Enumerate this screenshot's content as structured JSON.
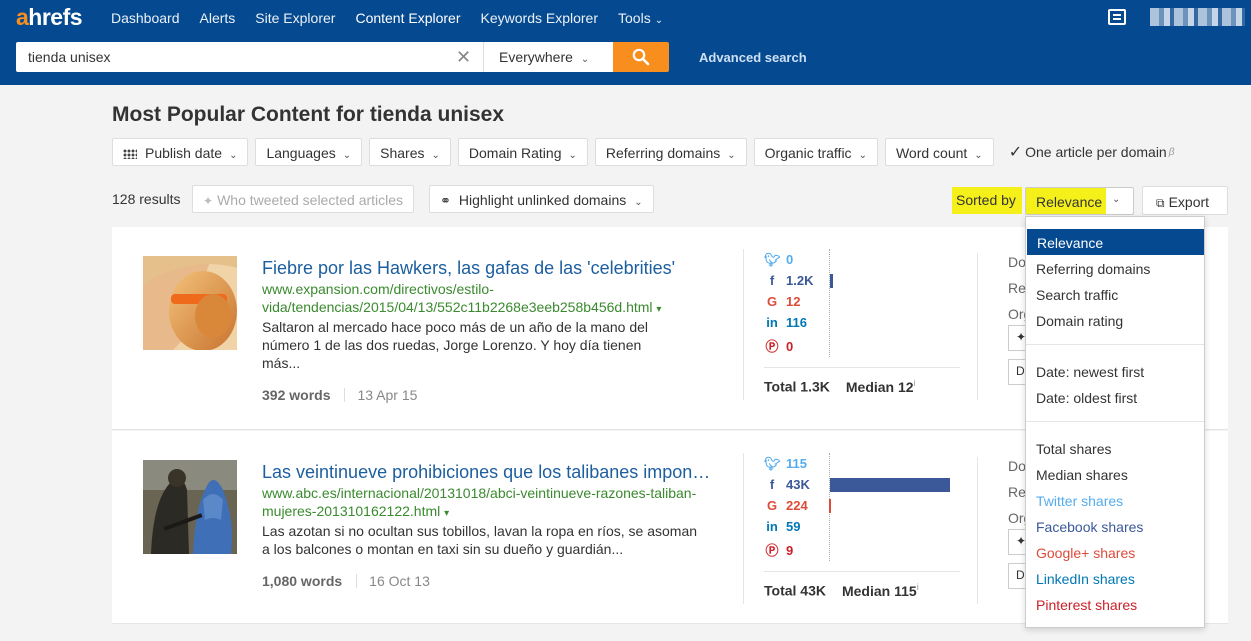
{
  "app": {
    "logo_a": "a",
    "logo_rest": "hrefs"
  },
  "nav": [
    {
      "label": "Dashboard"
    },
    {
      "label": "Alerts"
    },
    {
      "label": "Site Explorer"
    },
    {
      "label": "Content Explorer",
      "active": true
    },
    {
      "label": "Keywords Explorer"
    },
    {
      "label": "Tools",
      "has_dropdown": true
    }
  ],
  "search": {
    "query": "tienda unisex",
    "scope": "Everywhere",
    "advanced": "Advanced search"
  },
  "page_title": "Most Popular Content for tienda unisex",
  "filters": [
    "Publish date",
    "Languages",
    "Shares",
    "Domain Rating",
    "Referring domains",
    "Organic traffic",
    "Word count"
  ],
  "one_article": {
    "label": "One article per domain",
    "checked": true,
    "beta_mark": "β"
  },
  "toolbar": {
    "results": "128 results",
    "tweeted": "Who tweeted selected articles",
    "highlight": "Highlight unlinked domains",
    "sorted_by": "Sorted by",
    "sort_value": "Relevance",
    "export": "Export"
  },
  "results": [
    {
      "title": "Fiebre por las Hawkers, las gafas de las 'celebrities'",
      "url_line1": "www.expansion.com/directivos/estilo-",
      "url_line2": "vida/tendencias/2015/04/13/552c11b2268e3eeb258b456d.html",
      "desc_line1": "Saltaron al mercado hace poco más de un año de la mano del",
      "desc_line2": "número 1 de las dos ruedas, Jorge Lorenzo. Y hoy día tienen",
      "desc_line3": "más...",
      "words": "392 words",
      "date": "13 Apr 15",
      "shares": {
        "twitter": "0",
        "facebook": "1.2K",
        "google": "12",
        "linkedin": "116",
        "pinterest": "0",
        "facebook_bar_fraction": 0.028,
        "total": "Total 1.3K",
        "median": "Median 12"
      },
      "partial": [
        "Do",
        "Re",
        "Org"
      ]
    },
    {
      "title": "Las veintinueve prohibiciones que los talibanes impon…",
      "url_line1": "www.abc.es/internacional/20131018/abci-veintinueve-razones-taliban-",
      "url_line2": "mujeres-201310162122.html",
      "desc_line1": "Las azotan si no ocultan sus tobillos, lavan la ropa en ríos, se asoman",
      "desc_line2": "a los balcones o montan en taxi sin su dueño y guardián...",
      "desc_line3": "",
      "words": "1,080 words",
      "date": "16 Oct 13",
      "shares": {
        "twitter": "115",
        "facebook": "43K",
        "google": "224",
        "linkedin": "59",
        "pinterest": "9",
        "facebook_bar_fraction": 1.0,
        "total": "Total 43K",
        "median": "Median 115"
      },
      "partial": [
        "Do",
        "Re",
        "Org"
      ]
    }
  ],
  "sort_menu": {
    "group1": [
      "Relevance",
      "Referring domains",
      "Search traffic",
      "Domain rating"
    ],
    "group2": [
      "Date: newest first",
      "Date: oldest first"
    ],
    "group3": [
      "Total shares",
      "Median shares",
      "Twitter shares",
      "Facebook shares",
      "Google+ shares",
      "LinkedIn shares",
      "Pinterest shares"
    ],
    "selected": "Relevance"
  },
  "colors": {
    "brand_blue": "#054a91",
    "accent_orange": "#f78e1e",
    "highlight_yellow": "#f5f01a",
    "twitter": "#55acee",
    "facebook": "#3b5998",
    "google": "#dd4b39",
    "linkedin": "#0077b5",
    "pinterest": "#cb2027",
    "url_green": "#3a8a2e",
    "title_blue": "#1d5e9f"
  }
}
